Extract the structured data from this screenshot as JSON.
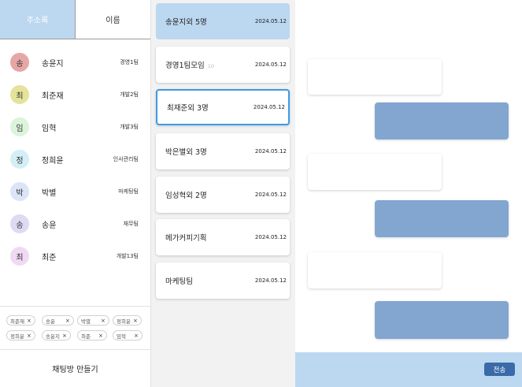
{
  "tabs": {
    "address_book": "주소록",
    "name": "이름"
  },
  "contacts": [
    {
      "initial": "송",
      "name": "송윤지",
      "team": "경영1팀",
      "color": "#e7a6a6"
    },
    {
      "initial": "최",
      "name": "최준재",
      "team": "개발2팀",
      "color": "#e5e39a"
    },
    {
      "initial": "임",
      "name": "임혁",
      "team": "개발3팀",
      "color": "#dcf3dc"
    },
    {
      "initial": "정",
      "name": "정희윤",
      "team": "인사관리팀",
      "color": "#d3eff5"
    },
    {
      "initial": "박",
      "name": "박별",
      "team": "마케팅팀",
      "color": "#dbe5f5"
    },
    {
      "initial": "송",
      "name": "송윤",
      "team": "재무팀",
      "color": "#dedaf2"
    },
    {
      "initial": "최",
      "name": "최준",
      "team": "개발13팀",
      "color": "#f0daf3"
    }
  ],
  "chips": [
    {
      "label": "최준재",
      "x": "×"
    },
    {
      "label": "송윤",
      "x": "×"
    },
    {
      "label": "박별",
      "x": "×"
    },
    {
      "label": "정희윤",
      "x": "×"
    },
    {
      "label": "정희윤",
      "x": "×"
    },
    {
      "label": "송윤지",
      "x": "×"
    },
    {
      "label": "최준",
      "x": "×"
    },
    {
      "label": "임혁",
      "x": "×"
    }
  ],
  "make_room_label": "채팅방 만들기",
  "rooms": [
    {
      "name": "송윤지외 5명",
      "count": "",
      "date": "2024.05.12"
    },
    {
      "name": "경영1팀모임",
      "count": "10",
      "date": "2024.05.12"
    },
    {
      "name": "최재준외 3명",
      "count": "",
      "date": "2024.05.12"
    },
    {
      "name": "박은별외 3명",
      "count": "",
      "date": "2024.05.12"
    },
    {
      "name": "임성혁외 2명",
      "count": "",
      "date": "2024.05.12"
    },
    {
      "name": "메가커피기획",
      "count": "",
      "date": "2024.05.12"
    },
    {
      "name": "마케팅팀",
      "count": "",
      "date": "2024.05.12"
    }
  ],
  "send_label": "전송"
}
